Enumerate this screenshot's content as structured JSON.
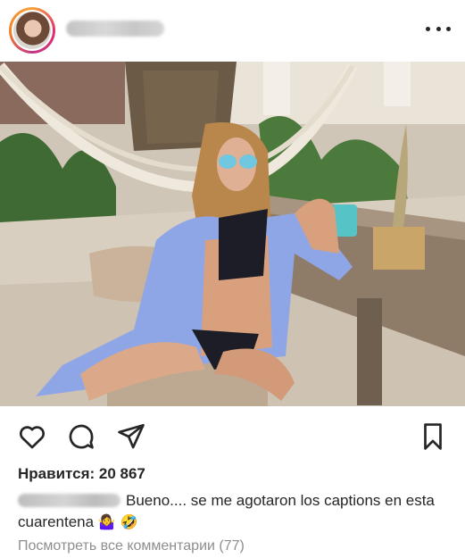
{
  "post": {
    "likes_text": "Нравится: 20 867",
    "caption_text": "Bueno.... se me agotaron los captions en esta cuarentena",
    "caption_emojis": [
      "🤷‍♀️",
      "🤣"
    ],
    "view_comments_text": "Посмотреть все комментарии (77)"
  },
  "icons": {
    "more": "more-horizontal-icon",
    "like": "heart-icon",
    "comment": "comment-icon",
    "share": "send-icon",
    "save": "bookmark-icon"
  },
  "colors": {
    "text": "#262626",
    "secondary_text": "#8e8e8e",
    "story_ring": [
      "#f7a239",
      "#e1306c",
      "#c13584"
    ]
  }
}
